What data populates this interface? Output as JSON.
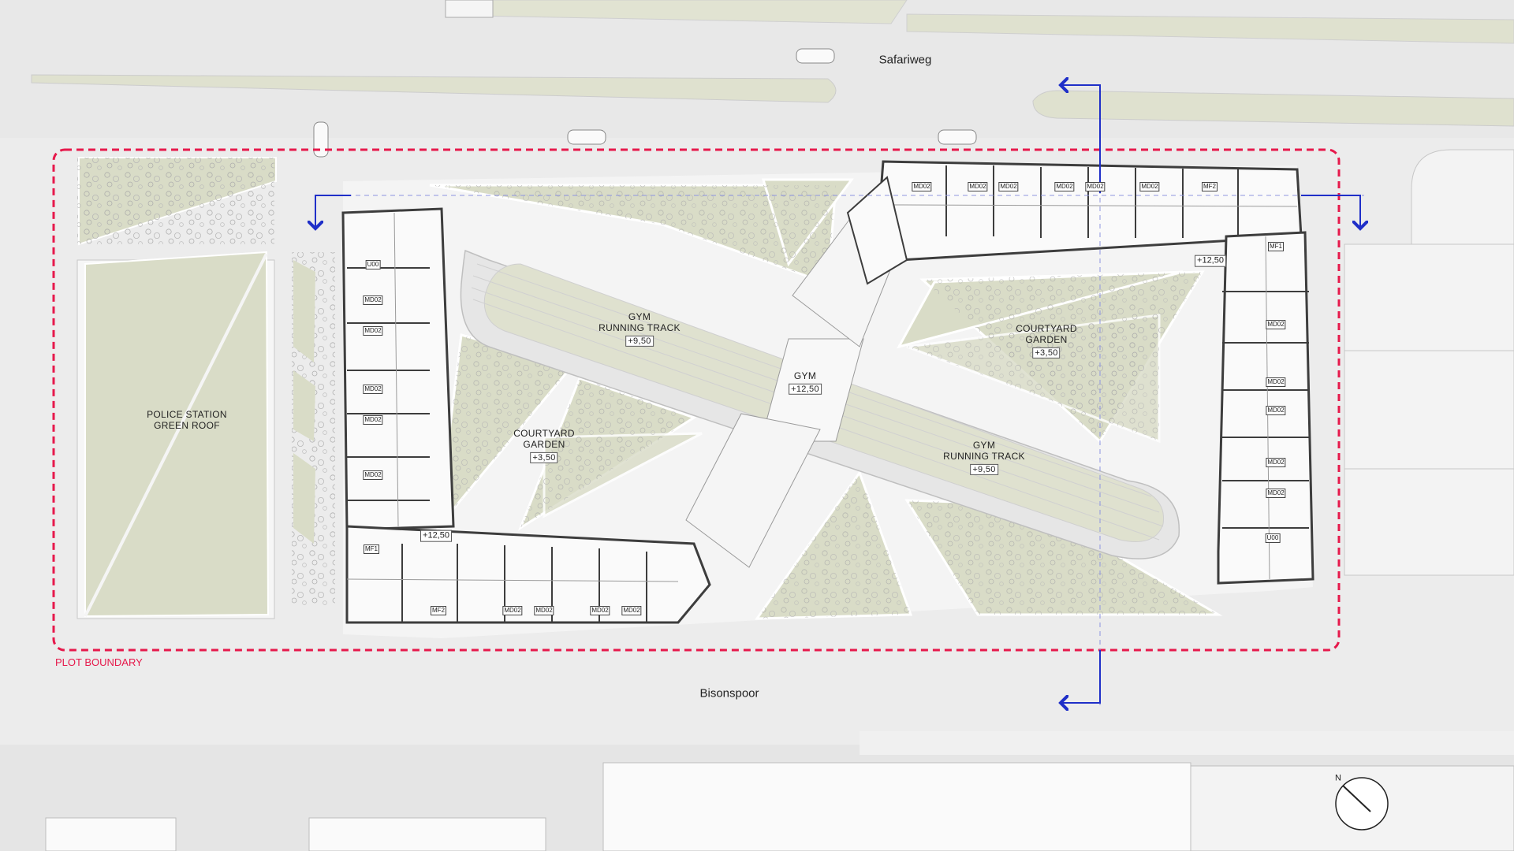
{
  "streets": {
    "north": "Safariweg",
    "south": "Bisonspoor"
  },
  "plot_boundary": {
    "label": "PLOT BOUNDARY",
    "color": "#e6194b"
  },
  "section_arrow_color": "#1f2fc8",
  "police": {
    "line1": "POLICE STATION",
    "line2": "GREEN ROOF"
  },
  "track_west": {
    "line1": "GYM",
    "line2": "RUNNING TRACK",
    "level": "+9,50"
  },
  "track_east": {
    "line1": "GYM",
    "line2": "RUNNING TRACK",
    "level": "+9,50"
  },
  "gym": {
    "line1": "GYM",
    "level": "+12,50"
  },
  "garden_west": {
    "line1": "COURTYARD",
    "line2": "GARDEN",
    "level": "+3,50"
  },
  "garden_east": {
    "line1": "COURTYARD",
    "line2": "GARDEN",
    "level": "+3,50"
  },
  "floor_levels": {
    "southwest": "+12,50",
    "northeast": "+12,50"
  },
  "unit_tags": {
    "west": [
      "U00",
      "MD02",
      "MD02",
      "MD02",
      "MD02",
      "MD02",
      "MF1"
    ],
    "south": [
      "MF2",
      "MD02",
      "MD02",
      "MD02",
      "MD02"
    ],
    "north": [
      "MD02",
      "MD02",
      "MD02",
      "MD02",
      "MD02",
      "MD02",
      "MF2"
    ],
    "east": [
      "MF1",
      "MD02",
      "MD02",
      "MD02",
      "MD02",
      "MD02",
      "U00"
    ]
  },
  "north_arrow": "N",
  "colors": {
    "green_roof": "#d9dcc7",
    "background": "#ececec",
    "building": "#f9f9f9",
    "wall": "#3d3d3d"
  }
}
